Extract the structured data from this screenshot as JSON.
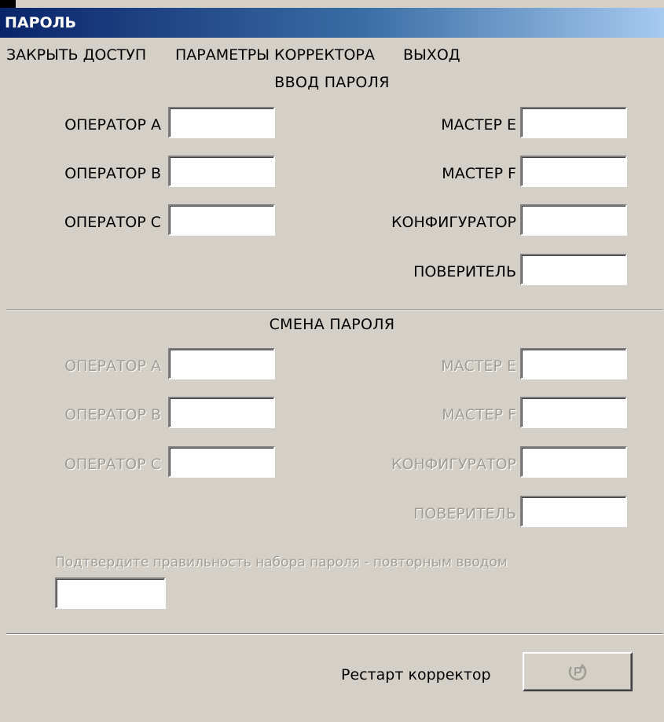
{
  "window": {
    "title": "ПАРОЛЬ",
    "title_gradient": [
      "#0a246a",
      "#a6caf0"
    ],
    "background": "#d4d0c8"
  },
  "menu": {
    "close_access": "ЗАКРЫТЬ ДОСТУП",
    "corrector_params": "ПАРАМЕТРЫ КОРРЕКТОРА",
    "exit": "ВЫХОД"
  },
  "password_entry": {
    "title": "ВВОД ПАРОЛЯ",
    "operator_a": {
      "label": "ОПЕРАТОР А",
      "value": ""
    },
    "operator_b": {
      "label": "ОПЕРАТОР В",
      "value": ""
    },
    "operator_c": {
      "label": "ОПЕРАТОР С",
      "value": ""
    },
    "master_e": {
      "label": "МАСТЕР Е",
      "value": ""
    },
    "master_f": {
      "label": "МАСТЕР F",
      "value": ""
    },
    "configurator": {
      "label": "КОНФИГУРАТОР",
      "value": ""
    },
    "verifier": {
      "label": "ПОВЕРИТЕЛЬ",
      "value": ""
    }
  },
  "password_change": {
    "title": "СМЕНА ПАРОЛЯ",
    "disabled": true,
    "operator_a": {
      "label": "ОПЕРАТОР А",
      "value": ""
    },
    "operator_b": {
      "label": "ОПЕРАТОР В",
      "value": ""
    },
    "operator_c": {
      "label": "ОПЕРАТОР С",
      "value": ""
    },
    "master_e": {
      "label": "МАСТЕР Е",
      "value": ""
    },
    "master_f": {
      "label": "МАСТЕР F",
      "value": ""
    },
    "configurator": {
      "label": "КОНФИГУРАТОР",
      "value": ""
    },
    "verifier": {
      "label": "ПОВЕРИТЕЛЬ",
      "value": ""
    },
    "confirm_text": "Подтвердите правильность набора пароля - повторным вводом",
    "confirm_value": ""
  },
  "footer": {
    "restart_label": "Рестарт корректор",
    "restart_icon": "restart-icon"
  }
}
